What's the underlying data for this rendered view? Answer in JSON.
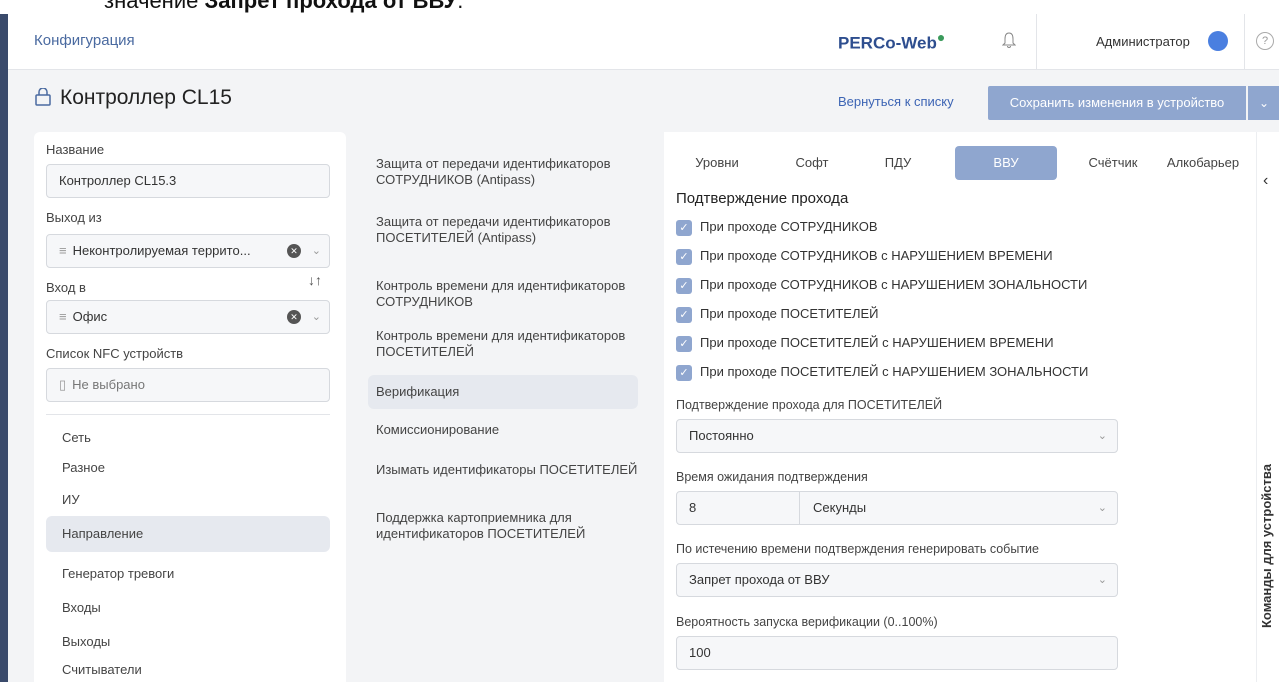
{
  "doc_caption": {
    "prefix": "значение ",
    "bold": "Запрет прохода от ВВУ",
    "suffix": "."
  },
  "topbar": {
    "title": "Конфигурация",
    "logo": "PERCo-Web",
    "user": "Администратор",
    "help": "?"
  },
  "header": {
    "title": "Контроллер CL15",
    "back_label": "Вернуться к списку",
    "save_label": "Сохранить изменения в устройство"
  },
  "left": {
    "name_label": "Название",
    "name_value": "Контроллер CL15.3",
    "exit_label": "Выход из",
    "exit_value": "Неконтролируемая террито...",
    "entry_label": "Вход в",
    "entry_value": "Офис",
    "nfc_label": "Список NFC устройств",
    "nfc_value": "Не выбрано",
    "nav": [
      "Сеть",
      "Разное",
      "ИУ",
      "Направление",
      "Генератор тревоги",
      "Входы",
      "Выходы",
      "Считыватели"
    ]
  },
  "middle": {
    "items": [
      "Защита от передачи идентификаторов СОТРУДНИКОВ (Antipass)",
      "Защита от передачи идентификаторов ПОСЕТИТЕЛЕЙ (Antipass)",
      "Контроль времени для идентификаторов СОТРУДНИКОВ",
      "Контроль времени для идентификаторов ПОСЕТИТЕЛЕЙ",
      "Верификация",
      "Комиссионирование",
      "Изымать идентификаторы ПОСЕТИТЕЛЕЙ",
      "Поддержка картоприемника для идентификаторов ПОСЕТИТЕЛЕЙ"
    ]
  },
  "right": {
    "tabs": [
      "Уровни",
      "Софт",
      "ПДУ",
      "ВВУ",
      "Счётчик",
      "Алкобарьер"
    ],
    "section_title": "Подтверждение прохода",
    "checks": [
      "При проходе СОТРУДНИКОВ",
      "При проходе СОТРУДНИКОВ с НАРУШЕНИЕМ ВРЕМЕНИ",
      "При проходе СОТРУДНИКОВ с НАРУШЕНИЕМ ЗОНАЛЬНОСТИ",
      "При проходе ПОСЕТИТЕЛЕЙ",
      "При проходе ПОСЕТИТЕЛЕЙ с НАРУШЕНИЕМ ВРЕМЕНИ",
      "При проходе ПОСЕТИТЕЛЕЙ с НАРУШЕНИЕМ ЗОНАЛЬНОСТИ"
    ],
    "visitors_confirm_label": "Подтверждение прохода для ПОСЕТИТЕЛЕЙ",
    "visitors_confirm_value": "Постоянно",
    "wait_label": "Время ожидания подтверждения",
    "wait_value": "8",
    "wait_unit": "Секунды",
    "event_label": "По истечению времени подтверждения генерировать событие",
    "event_value": "Запрет прохода от ВВУ",
    "prob_label": "Вероятность запуска верификации (0..100%)",
    "prob_value": "100"
  },
  "side_panel": {
    "label": "Команды для устройства"
  }
}
